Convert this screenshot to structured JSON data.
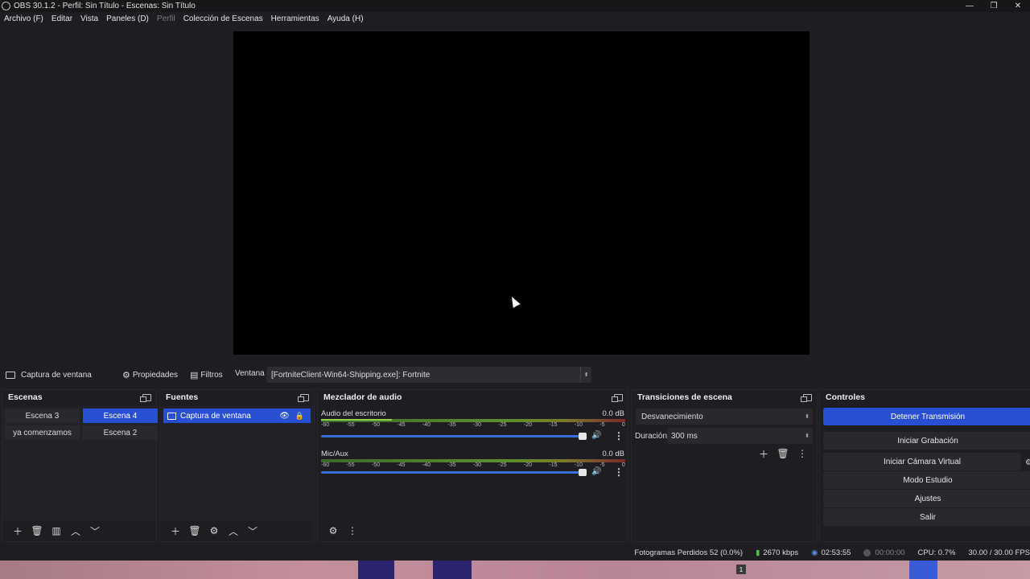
{
  "window": {
    "title": "OBS 30.1.2 - Perfil: Sin Título - Escenas: Sin Título",
    "controls": {
      "minimize": "—",
      "maximize": "❐",
      "close": "✕"
    }
  },
  "menu": {
    "items": [
      {
        "label": "Archivo (F)",
        "enabled": true
      },
      {
        "label": "Editar",
        "enabled": true
      },
      {
        "label": "Vista",
        "enabled": true
      },
      {
        "label": "Paneles (D)",
        "enabled": true
      },
      {
        "label": "Perfil",
        "enabled": false
      },
      {
        "label": "Colección de Escenas",
        "enabled": true
      },
      {
        "label": "Herramientas",
        "enabled": true
      },
      {
        "label": "Ayuda (H)",
        "enabled": true
      }
    ]
  },
  "context_bar": {
    "source_name": "Captura de ventana",
    "properties_label": "Propiedades",
    "filters_label": "Filtros",
    "window_label": "Ventana",
    "window_value": "[FortniteClient-Win64-Shipping.exe]: Fortnite"
  },
  "scenes": {
    "title": "Escenas",
    "items": [
      {
        "label": "Escena 3",
        "active": false
      },
      {
        "label": "Escena 4",
        "active": true
      },
      {
        "label": "ya comenzamos",
        "active": false
      },
      {
        "label": "Escena 2",
        "active": false
      }
    ]
  },
  "sources": {
    "title": "Fuentes",
    "items": [
      {
        "label": "Captura de ventana",
        "visible": true,
        "locked": false
      }
    ]
  },
  "mixer": {
    "title": "Mezclador de audio",
    "ticks": [
      "-60",
      "-55",
      "-50",
      "-45",
      "-40",
      "-35",
      "-30",
      "-25",
      "-20",
      "-15",
      "-10",
      "-5",
      "0"
    ],
    "channels": [
      {
        "name": "Audio del escritorio",
        "db": "0.0 dB"
      },
      {
        "name": "Mic/Aux",
        "db": "0.0 dB"
      }
    ]
  },
  "transitions": {
    "title": "Transiciones de escena",
    "selected": "Desvanecimiento",
    "duration_label": "Duración",
    "duration_value": "300 ms"
  },
  "controls": {
    "title": "Controles",
    "buttons": {
      "stop_stream": "Detener Transmisión",
      "start_recording": "Iniciar Grabación",
      "start_virtual_cam": "Iniciar Cámara Virtual",
      "studio_mode": "Modo Estudio",
      "settings": "Ajustes",
      "exit": "Salir"
    }
  },
  "status": {
    "dropped_frames": "Fotogramas Perdidos 52 (0.0%)",
    "bitrate": "2670 kbps",
    "stream_time": "02:53:55",
    "rec_time": "00:00:00",
    "cpu": "CPU: 0.7%",
    "fps": "30.00 / 30.00 FPS"
  },
  "taskbar": {
    "badge": "1"
  }
}
